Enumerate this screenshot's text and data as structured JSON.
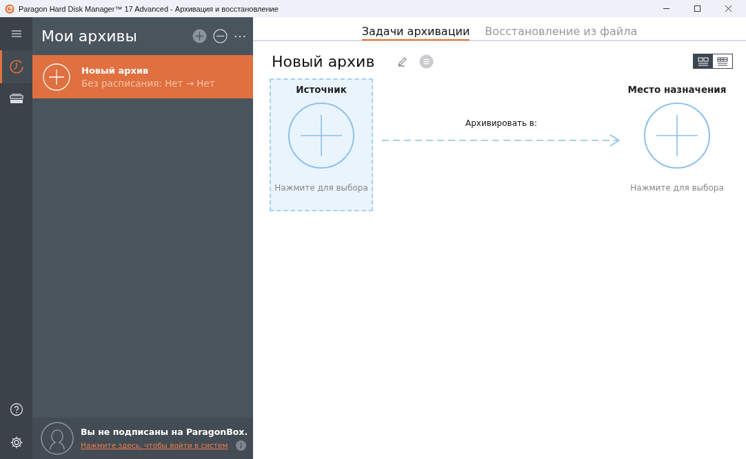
{
  "window": {
    "title": "Paragon Hard Disk Manager™ 17 Advanced - Архивация и восстановление"
  },
  "rail": {
    "top": [
      {
        "kind": "menu",
        "selected": false
      },
      {
        "kind": "clock",
        "selected": true
      },
      {
        "kind": "drives",
        "selected": false
      }
    ],
    "bottom": [
      {
        "kind": "help",
        "selected": false
      },
      {
        "kind": "settings",
        "selected": false
      }
    ]
  },
  "panel": {
    "title": "Мои архивы",
    "archives": [
      {
        "name": "Новый архив",
        "schedule": "Без расписания: Нет → Нет",
        "selected": true
      }
    ],
    "account": {
      "message": "Вы не подписаны на ParagonBox.",
      "link": "Нажмите здесь, чтобы войти в систем"
    }
  },
  "tabs": [
    {
      "label": "Задачи архивации",
      "selected": true
    },
    {
      "label": "Восстановление из файла",
      "selected": false
    }
  ],
  "task": {
    "title": "Новый архив",
    "view_modes": [
      {
        "kind": "tiles",
        "selected": true
      },
      {
        "kind": "list",
        "selected": false
      }
    ],
    "source": {
      "heading": "Источник",
      "hint": "Нажмите для выбора",
      "selected": true
    },
    "arrow_label": "Архивировать в:",
    "destination": {
      "heading": "Место назначения",
      "hint": "Нажмите для выбора",
      "selected": false
    }
  }
}
